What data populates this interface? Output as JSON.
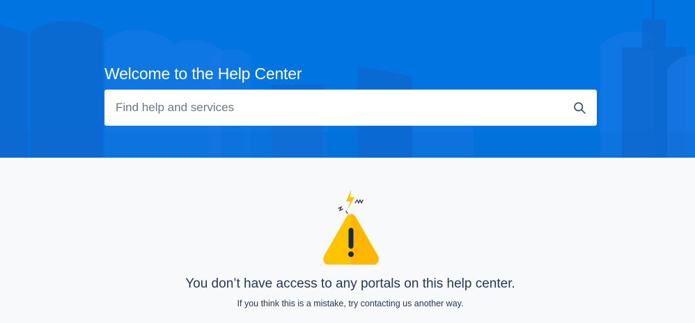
{
  "hero": {
    "title": "Welcome to the Help Center",
    "background_color": "#0074e0"
  },
  "search": {
    "placeholder": "Find help and services",
    "value": "",
    "icon": "search-icon"
  },
  "message": {
    "icon": "warning-icon",
    "title": "You don’t have access to any portals on this help center.",
    "subtitle": "If you think this is a mistake, try contacting us another way.",
    "accent_color": "#ffc400"
  }
}
